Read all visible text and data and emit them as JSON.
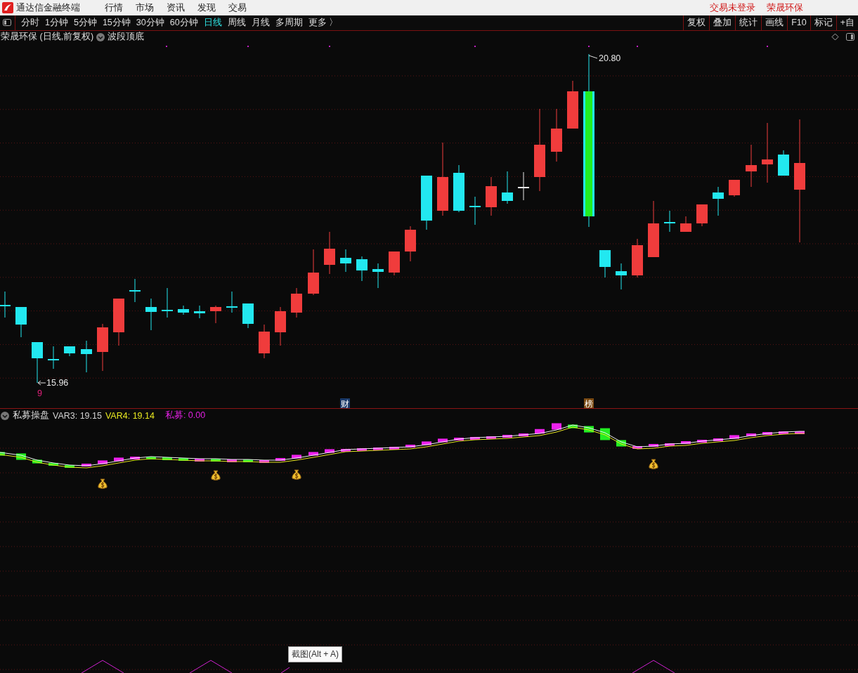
{
  "app": {
    "title": "通达信金融终端",
    "menu": [
      "行情",
      "市场",
      "资讯",
      "发现",
      "交易"
    ],
    "account": [
      "交易未登录",
      "荣晟环保"
    ]
  },
  "periods": [
    {
      "label": "分时",
      "selected": false
    },
    {
      "label": "1分钟",
      "selected": false
    },
    {
      "label": "5分钟",
      "selected": false
    },
    {
      "label": "15分钟",
      "selected": false
    },
    {
      "label": "30分钟",
      "selected": false
    },
    {
      "label": "60分钟",
      "selected": false
    },
    {
      "label": "日线",
      "selected": true
    },
    {
      "label": "周线",
      "selected": false
    },
    {
      "label": "月线",
      "selected": false
    },
    {
      "label": "多周期",
      "selected": false
    },
    {
      "label": "更多 〉",
      "selected": false
    }
  ],
  "tools": [
    "复权",
    "叠加",
    "统计",
    "画线",
    "F10",
    "标记",
    "+自"
  ],
  "chart": {
    "title": "荣晟环保 (日线,前复权)",
    "indicator": "波段顶底",
    "high_label": "20.80",
    "low_label": "15.96",
    "low_count": "9",
    "event_markers": [
      {
        "text": "财",
        "kind": "finance"
      },
      {
        "text": "榜",
        "kind": "ranking"
      }
    ]
  },
  "indicator": {
    "name": "私募操盘",
    "values": [
      {
        "text": "VAR3: 19.15",
        "color": "#d2d2d2"
      },
      {
        "text": "VAR4: 19.14",
        "color": "#e6e620"
      },
      {
        "text": "私募: 0.00",
        "color": "#e020e0"
      }
    ]
  },
  "tooltip": "截图(Alt + A)"
}
